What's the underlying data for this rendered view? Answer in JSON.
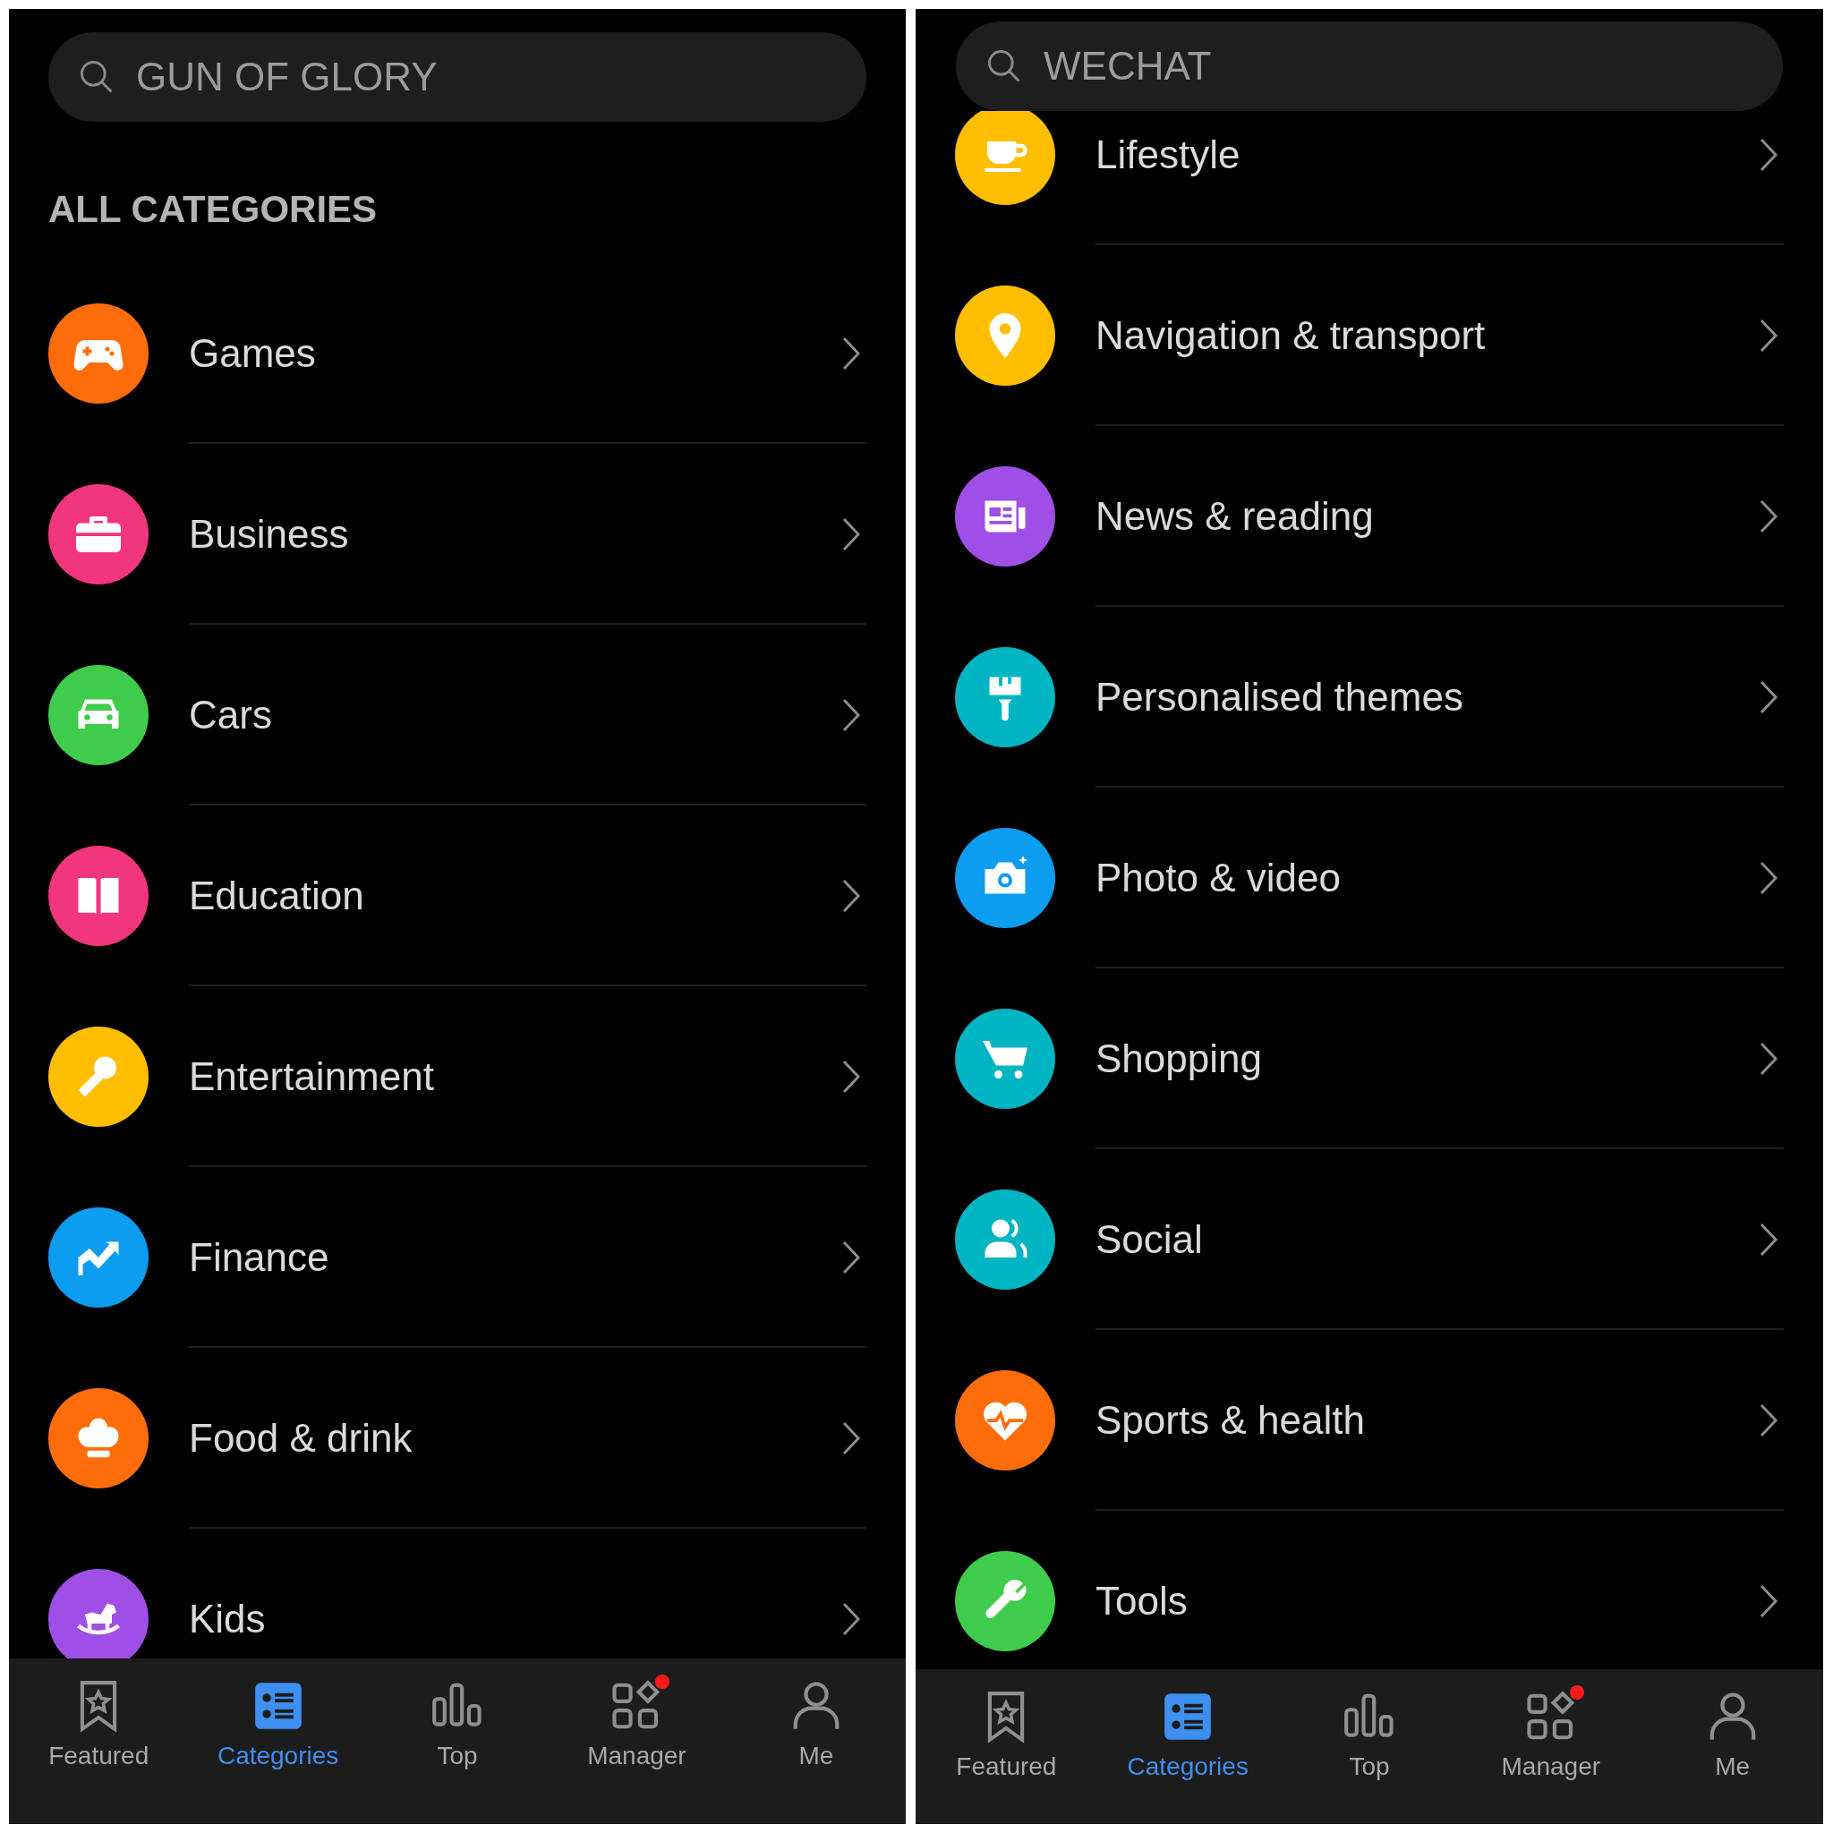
{
  "panels": [
    {
      "search": {
        "value": "GUN OF GLORY"
      },
      "heading": "ALL CATEGORIES",
      "categories": [
        {
          "label": "Games",
          "color": "#ff6d0a"
        },
        {
          "label": "Business",
          "color": "#f2357f"
        },
        {
          "label": "Cars",
          "color": "#3fcb4b"
        },
        {
          "label": "Education",
          "color": "#f2357f"
        },
        {
          "label": "Entertainment",
          "color": "#ffbe00"
        },
        {
          "label": "Finance",
          "color": "#0c9cf0"
        },
        {
          "label": "Food & drink",
          "color": "#ff6d0a"
        },
        {
          "label": "Kids",
          "color": "#a04fe6"
        }
      ],
      "nav": [
        {
          "label": "Featured",
          "selected": false,
          "badge": false
        },
        {
          "label": "Categories",
          "selected": true,
          "badge": false
        },
        {
          "label": "Top",
          "selected": false,
          "badge": false
        },
        {
          "label": "Manager",
          "selected": false,
          "badge": true
        },
        {
          "label": "Me",
          "selected": false,
          "badge": false
        }
      ]
    },
    {
      "search": {
        "value": "WECHAT"
      },
      "categories": [
        {
          "label": "Lifestyle",
          "color": "#ffbe00"
        },
        {
          "label": "Navigation & transport",
          "color": "#ffbe00"
        },
        {
          "label": "News & reading",
          "color": "#a04fe6"
        },
        {
          "label": "Personalised themes",
          "color": "#00b5c2"
        },
        {
          "label": "Photo & video",
          "color": "#0c9cf0"
        },
        {
          "label": "Shopping",
          "color": "#00b5c2"
        },
        {
          "label": "Social",
          "color": "#00b5c2"
        },
        {
          "label": "Sports & health",
          "color": "#ff6d0a"
        },
        {
          "label": "Tools",
          "color": "#3fcb4b"
        }
      ],
      "nav": [
        {
          "label": "Featured",
          "selected": false,
          "badge": false
        },
        {
          "label": "Categories",
          "selected": true,
          "badge": false
        },
        {
          "label": "Top",
          "selected": false,
          "badge": false
        },
        {
          "label": "Manager",
          "selected": false,
          "badge": true
        },
        {
          "label": "Me",
          "selected": false,
          "badge": false
        }
      ]
    }
  ]
}
